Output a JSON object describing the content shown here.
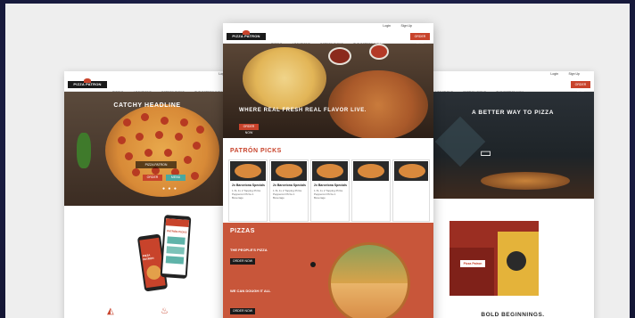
{
  "colors": {
    "brand_red": "#c8432b",
    "dark": "#1a1a1a",
    "orange_section": "#c8563a",
    "teal": "#4aa8a0"
  },
  "left_page": {
    "logo": "PIZZA PATRON",
    "top_links": [
      "Login"
    ],
    "nav": [
      "PIZZAS",
      "LOCATIONS",
      "PATRON PICKS",
      "THE PATRON WAY"
    ],
    "hero_title": "CATCHY HEADLINE",
    "hero_badge": "PIZZA PATRON",
    "hero_buttons": [
      "ORDER",
      "MENU"
    ],
    "phone_texts": [
      "PIZZA PATRON",
      "PATRÓN PICKS"
    ]
  },
  "center_page": {
    "logo": "PIZZA PATRON",
    "top_links": [
      "Login",
      "Sign Up"
    ],
    "nav": [
      "PIZZAS",
      "LOCATIONS",
      "PATRON PICKS",
      "THE PATRON WAY"
    ],
    "order_btn": "ORDER NOW",
    "hero_title": "WHERE REAL FRESH REAL FLAVOR LIVE.",
    "hero_btn": "ORDER NOW",
    "section_title": "PATRÓN PICKS",
    "cards": [
      {
        "title": "2x Barcelona Specials",
        "desc": "1 XL 1x 2 Topping Pizza Pepperoni Pizza 1 Beverage"
      },
      {
        "title": "2x Barcelona Specials",
        "desc": "1 XL 1x 2 Topping Pizza Pepperoni Pizza 1 Beverage"
      },
      {
        "title": "2x Barcelona Specials",
        "desc": "1 XL 1x 2 Topping Pizza Pepperoni Pizza 1 Beverage"
      }
    ],
    "pizzas_title": "PIZZAS",
    "pizzas_sub": "THE PEOPLE'S PIZZA",
    "pizzas_btn": "ORDER NOW",
    "pizzas_sub2": "WE CAN DOUGH IT ALL",
    "pizzas_btn2": "ORDER NOW"
  },
  "right_page": {
    "top_links": [
      "Login",
      "Sign Up"
    ],
    "nav": [
      "LOCATIONS",
      "PATRON PICKS",
      "THE PATRON WAY"
    ],
    "order_btn": "ORDER NOW",
    "hero_title": "A BETTER WAY TO PIZZA",
    "video_icon": "video-camera-icon",
    "store_sign": "Pizza Patron",
    "bottom_title": "BOLD BEGINNINGS."
  }
}
